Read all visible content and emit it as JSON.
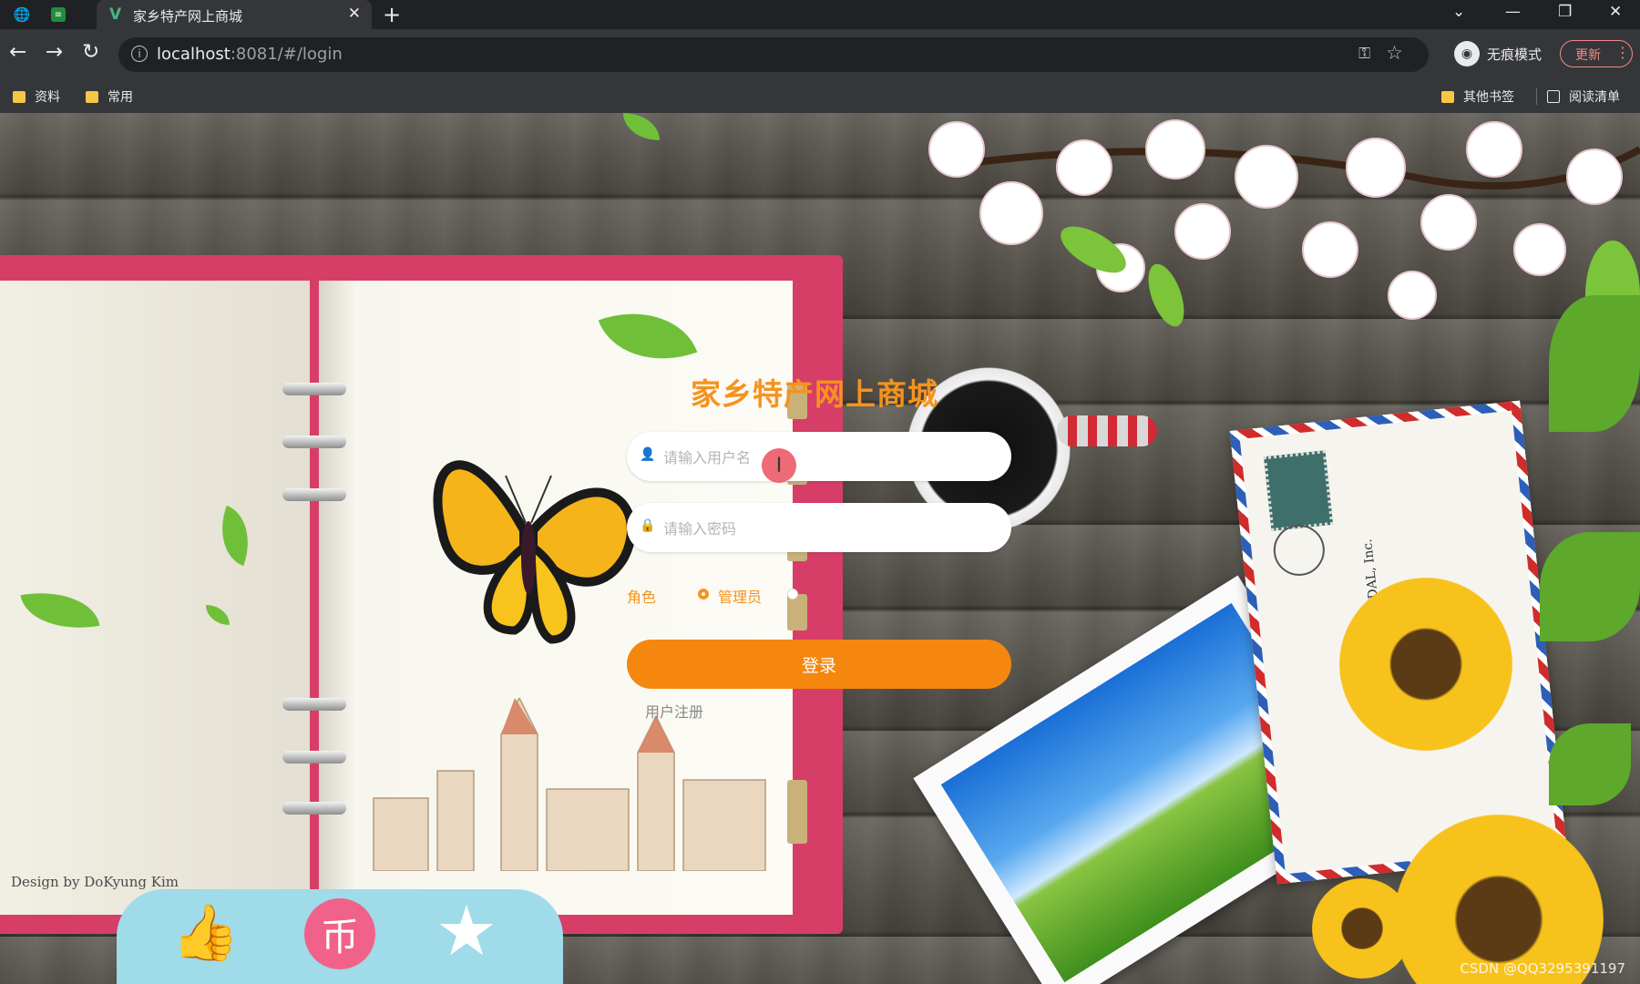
{
  "browser": {
    "tab_title": "家乡特产网上商城",
    "url_host": "localhost",
    "url_rest": ":8081/#/login",
    "incognito_label": "无痕模式",
    "update_label": "更新"
  },
  "bookmarks": {
    "items": [
      "资料",
      "常用"
    ],
    "other_label": "其他书签",
    "reading_list_label": "阅读清单"
  },
  "login": {
    "title": "家乡特产网上商城",
    "username_placeholder": "请输入用户名",
    "password_placeholder": "请输入密码",
    "role_label": "角色",
    "role_option": "管理员",
    "login_button": "登录",
    "register_link": "用户注册"
  },
  "decor": {
    "design_credit": "Design by DoKyung Kim",
    "envelope_text": "ADAL, Inc.",
    "watermark": "CSDN @QQ3295391197"
  },
  "icons": [
    "globe-icon",
    "sheet-icon",
    "vue-icon",
    "close-icon",
    "plus-icon",
    "back-icon",
    "forward-icon",
    "reload-icon",
    "info-icon",
    "key-icon",
    "star-icon",
    "incognito-icon",
    "folder-icon",
    "reading-list-icon",
    "user-icon",
    "lock-icon",
    "text-cursor-icon",
    "thumbs-up-icon",
    "coin-icon",
    "favorite-star-icon"
  ]
}
